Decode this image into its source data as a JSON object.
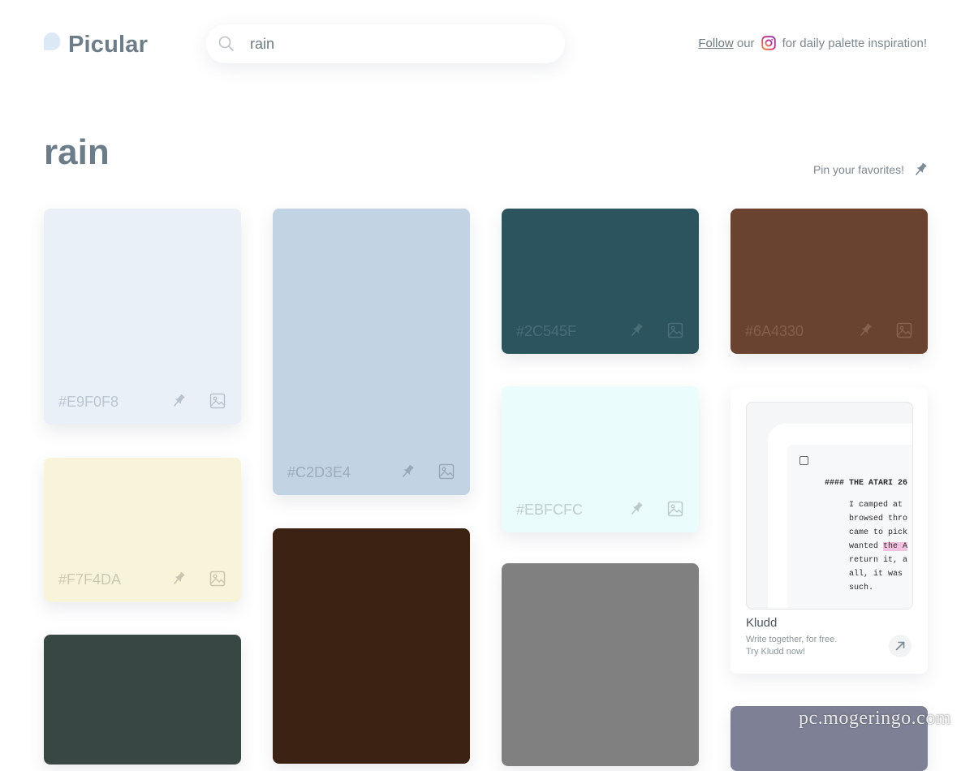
{
  "header": {
    "logo_text": "Picular",
    "search": {
      "value": "rain",
      "placeholder": ""
    },
    "insta_follow": "Follow",
    "insta_our": "our",
    "insta_tail": "for daily palette inspiration!"
  },
  "page": {
    "title": "rain",
    "pin_hint": "Pin your favorites!"
  },
  "swatches": [
    {
      "hex": "#E9F0F8",
      "color": "#E9F0F8",
      "text_color": "#b7c2cc",
      "icon_color": "#b7c2cc"
    },
    {
      "hex": "#F7F4DA",
      "color": "#F7F4DA",
      "text_color": "#c9c6b0",
      "icon_color": "#c9c6b0"
    },
    {
      "hex": "",
      "color": "#384744"
    },
    {
      "hex": "#C2D3E4",
      "color": "#C2D3E4",
      "text_color": "#98a8b8",
      "icon_color": "#98a8b8"
    },
    {
      "hex": "",
      "color": "#3B2213"
    },
    {
      "hex": "#2C545F",
      "color": "#2C545F",
      "text_color": "#4b6f79",
      "icon_color": "#4b6f79"
    },
    {
      "hex": "#EBFCFC",
      "color": "#EBFCFC",
      "text_color": "#bcc9c9",
      "icon_color": "#bcc9c9"
    },
    {
      "hex": "",
      "color": "#808080"
    },
    {
      "hex": "#6A4330",
      "color": "#6A4330",
      "text_color": "#87614f",
      "icon_color": "#87614f"
    },
    {
      "hex": "",
      "color": "#7E8196"
    }
  ],
  "ad": {
    "doc_heading": "#### THE ATARI 26",
    "doc_line1": "I camped at",
    "doc_line2": "browsed thro",
    "doc_line3": "came to pick",
    "doc_line4_pre": "wanted ",
    "doc_line4_hl": "the A",
    "doc_line5": "return it, a",
    "doc_line6": "all, it was",
    "doc_line7": "such.",
    "title": "Kludd",
    "sub1": "Write together, for free.",
    "sub2": "Try Kludd now!"
  },
  "watermark": "pc.mogeringo.com",
  "icons": {
    "search": "search-icon",
    "instagram": "instagram-icon",
    "pin": "pin-icon",
    "image": "image-icon",
    "arrow": "arrow-up-right-icon"
  },
  "colors": {
    "brand_text": "#6C7D89",
    "instagram_gradient": [
      "#F58529",
      "#DD2A7B",
      "#8134AF"
    ]
  }
}
